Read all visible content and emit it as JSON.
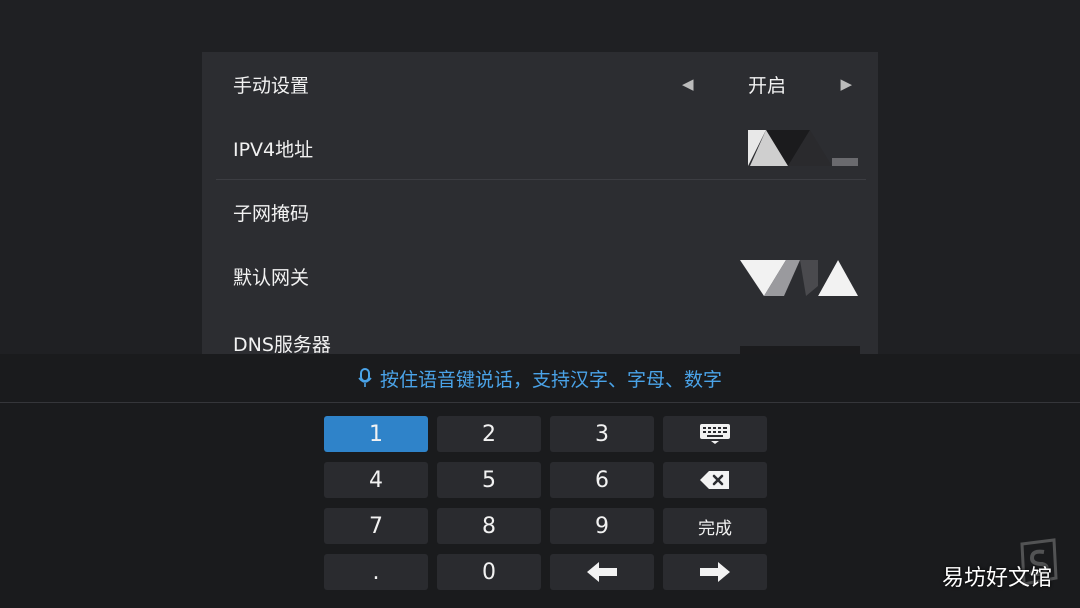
{
  "settings": {
    "rows": [
      {
        "label": "手动设置",
        "value": "开启"
      },
      {
        "label": "IPV4地址"
      },
      {
        "label": "子网掩码"
      },
      {
        "label": "默认网关"
      },
      {
        "label": "DNS服务器"
      }
    ]
  },
  "ime": {
    "hint": "按住语音键说话，支持汉字、字母、数字"
  },
  "keypad": {
    "keys": [
      "1",
      "2",
      "3",
      "4",
      "5",
      "6",
      "7",
      "8",
      "9",
      ".",
      "0"
    ],
    "done_label": "完成"
  },
  "watermark": "易坊好文馆",
  "colors": {
    "accent": "#2f83c9",
    "hint_text": "#4aa3e8",
    "panel": "#2c2d31",
    "background": "#1f2023"
  },
  "icons": {
    "keyboard_toggle": "keyboard-icon",
    "backspace": "backspace-icon",
    "left": "arrow-left-icon",
    "right": "arrow-right-icon",
    "mic": "mic-icon",
    "selector_prev": "triangle-left-icon",
    "selector_next": "triangle-right-icon"
  }
}
